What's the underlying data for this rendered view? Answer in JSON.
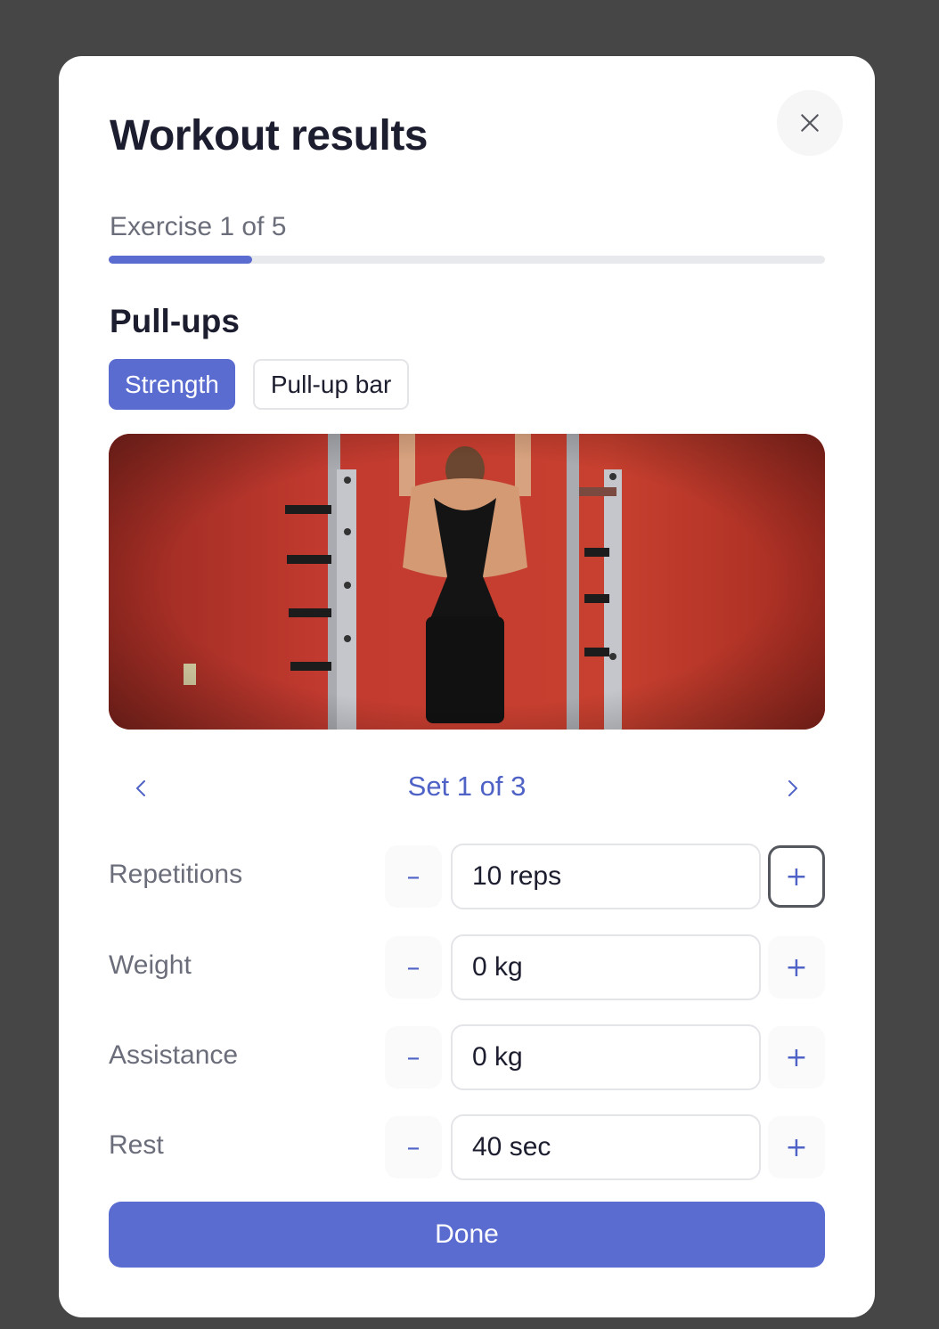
{
  "modal": {
    "title": "Workout results",
    "close_icon": "close-icon"
  },
  "progress": {
    "label": "Exercise 1 of 5",
    "fraction": 0.2,
    "color": "#5a6cd0"
  },
  "exercise": {
    "name": "Pull-ups",
    "tags": [
      "Strength",
      "Pull-up bar"
    ],
    "image_alt_icon": "exercise-video-thumbnail"
  },
  "set_nav": {
    "label": "Set 1 of 3",
    "prev_icon": "chevron-left-icon",
    "next_icon": "chevron-right-icon"
  },
  "fields": [
    {
      "label": "Repetitions",
      "value": "10 reps",
      "minus": "–",
      "plus": "+"
    },
    {
      "label": "Weight",
      "value": "0 kg",
      "minus": "–",
      "plus": "+"
    },
    {
      "label": "Assistance",
      "value": "0 kg",
      "minus": "–",
      "plus": "+"
    },
    {
      "label": "Rest",
      "value": "40 sec",
      "minus": "–",
      "plus": "+"
    }
  ],
  "done_label": "Done",
  "colors": {
    "accent": "#5a6cd0",
    "accent_text": "#4f62c6",
    "backdrop": "#464646"
  }
}
